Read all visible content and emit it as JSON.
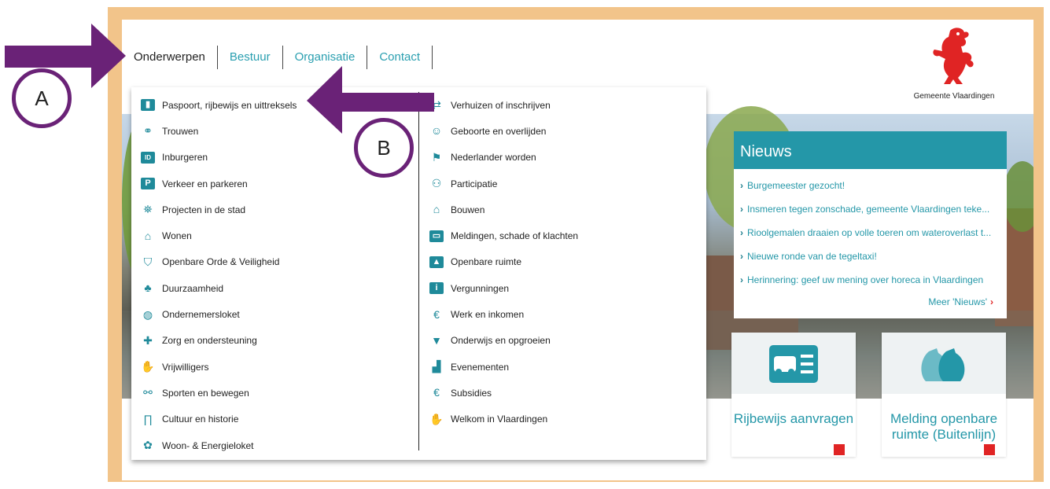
{
  "nav": [
    "Onderwerpen",
    "Bestuur",
    "Organisatie",
    "Contact"
  ],
  "logo": {
    "name": "Gemeente Vlaardingen"
  },
  "menu": {
    "left": [
      {
        "label": "Paspoort, rijbewijs en uittreksels",
        "icon": "passport-icon"
      },
      {
        "label": "Trouwen",
        "icon": "rings-icon"
      },
      {
        "label": "Inburgeren",
        "icon": "id-card-icon"
      },
      {
        "label": "Verkeer en parkeren",
        "icon": "parking-icon"
      },
      {
        "label": "Projecten in de stad",
        "icon": "map-icon"
      },
      {
        "label": "Wonen",
        "icon": "house-icon"
      },
      {
        "label": "Openbare Orde & Veiligheid",
        "icon": "shield-icon"
      },
      {
        "label": "Duurzaamheid",
        "icon": "plant-hand-icon"
      },
      {
        "label": "Ondernemersloket",
        "icon": "handshake-icon"
      },
      {
        "label": "Zorg en ondersteuning",
        "icon": "care-hand-icon"
      },
      {
        "label": "Vrijwilligers",
        "icon": "hand-icon"
      },
      {
        "label": "Sporten en bewegen",
        "icon": "bicycle-icon"
      },
      {
        "label": "Cultuur en historie",
        "icon": "arch-icon"
      },
      {
        "label": "Woon- & Energieloket",
        "icon": "energy-icon"
      }
    ],
    "right": [
      {
        "label": "Verhuizen of inschrijven",
        "icon": "moving-icon"
      },
      {
        "label": "Geboorte en overlijden",
        "icon": "baby-icon"
      },
      {
        "label": "Nederlander worden",
        "icon": "flag-icon"
      },
      {
        "label": "Participatie",
        "icon": "people-icon"
      },
      {
        "label": "Bouwen",
        "icon": "house-icon"
      },
      {
        "label": "Meldingen, schade of klachten",
        "icon": "laptop-icon"
      },
      {
        "label": "Openbare ruimte",
        "icon": "public-space-icon"
      },
      {
        "label": "Vergunningen",
        "icon": "permit-icon"
      },
      {
        "label": "Werk en inkomen",
        "icon": "euro-cycle-icon"
      },
      {
        "label": "Onderwijs en opgroeien",
        "icon": "graduation-icon"
      },
      {
        "label": "Evenementen",
        "icon": "events-icon"
      },
      {
        "label": "Subsidies",
        "icon": "euro-hand-icon"
      },
      {
        "label": "Welkom in Vlaardingen",
        "icon": "hand-icon"
      }
    ]
  },
  "news": {
    "title": "Nieuws",
    "items": [
      "Burgemeester gezocht!",
      "Insmeren tegen zonschade, gemeente Vlaardingen teke...",
      "Rioolgemalen draaien op volle toeren om wateroverlast t...",
      "Nieuwe ronde van de tegeltaxi!",
      "Herinnering: geef uw mening over horeca in Vlaardingen"
    ],
    "more": "Meer 'Nieuws'"
  },
  "tiles": [
    {
      "title": "Rijbewijs aanvragen",
      "icon": "drivers-license-icon"
    },
    {
      "title": "Melding openbare ruimte (Buitenlijn)",
      "icon": "bags-icon"
    }
  ],
  "annotations": {
    "a": "A",
    "b": "B"
  },
  "colors": {
    "accent": "#2497a8",
    "frame": "#f2c48a",
    "arrow": "#6a2277",
    "red": "#e02424"
  }
}
